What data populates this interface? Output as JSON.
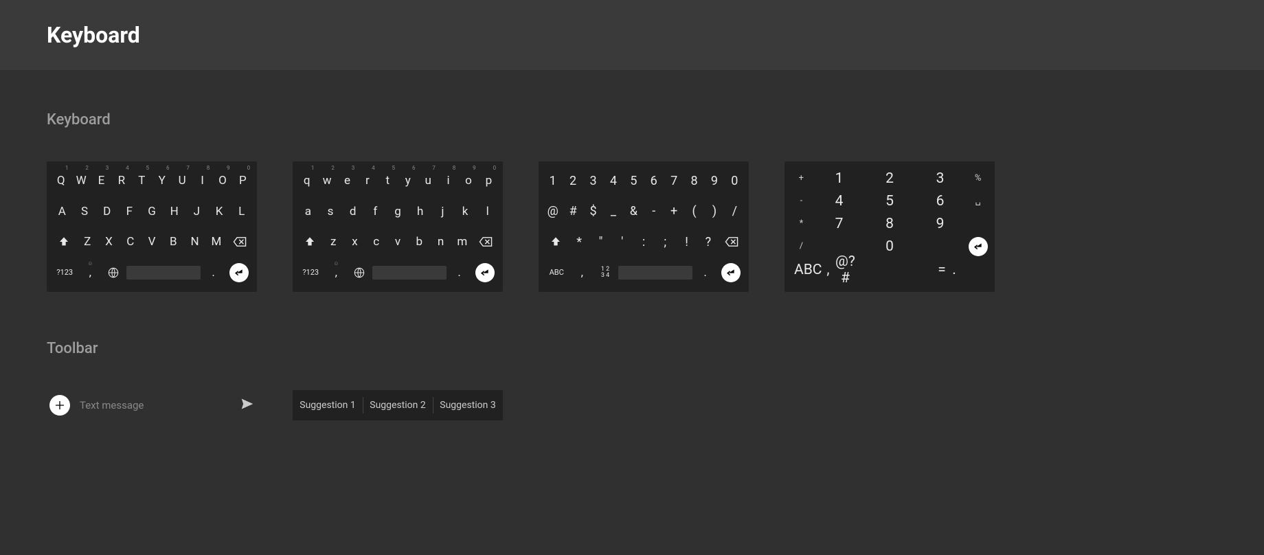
{
  "page_title": "Keyboard",
  "sections": {
    "keyboard_heading": "Keyboard",
    "toolbar_heading": "Toolbar"
  },
  "qwerty_upper": {
    "row1": [
      "Q",
      "W",
      "E",
      "R",
      "T",
      "Y",
      "U",
      "I",
      "O",
      "P"
    ],
    "row1_sup": [
      "1",
      "2",
      "3",
      "4",
      "5",
      "6",
      "7",
      "8",
      "9",
      "0"
    ],
    "row2": [
      "A",
      "S",
      "D",
      "F",
      "G",
      "H",
      "J",
      "K",
      "L"
    ],
    "row3": [
      "Z",
      "X",
      "C",
      "V",
      "B",
      "N",
      "M"
    ],
    "mode_key": "?123",
    "comma": ",",
    "period": "."
  },
  "qwerty_lower": {
    "row1": [
      "q",
      "w",
      "e",
      "r",
      "t",
      "y",
      "u",
      "i",
      "o",
      "p"
    ],
    "row1_sup": [
      "1",
      "2",
      "3",
      "4",
      "5",
      "6",
      "7",
      "8",
      "9",
      "0"
    ],
    "row2": [
      "a",
      "s",
      "d",
      "f",
      "g",
      "h",
      "j",
      "k",
      "l"
    ],
    "row3": [
      "z",
      "x",
      "c",
      "v",
      "b",
      "n",
      "m"
    ],
    "mode_key": "?123",
    "comma": ",",
    "period": "."
  },
  "symbols": {
    "row1": [
      "1",
      "2",
      "3",
      "4",
      "5",
      "6",
      "7",
      "8",
      "9",
      "0"
    ],
    "row2": [
      "@",
      "#",
      "$",
      "_",
      "&",
      "-",
      "+",
      "(",
      ")",
      "/"
    ],
    "row3": [
      "*",
      "\"",
      "'",
      ":",
      ";",
      "!",
      "?"
    ],
    "mode_key": "ABC",
    "switch_key_top": "1 2",
    "switch_key_bot": "3 4",
    "comma": ",",
    "period": "."
  },
  "numpad": {
    "left_col": [
      "+",
      "-",
      "*",
      "/"
    ],
    "grid": [
      [
        "1",
        "2",
        "3"
      ],
      [
        "4",
        "5",
        "6"
      ],
      [
        "7",
        "8",
        "9"
      ],
      [
        "",
        "0",
        ""
      ]
    ],
    "right_col": [
      "%",
      "␣",
      "",
      ""
    ],
    "bottom_left_mode": "ABC",
    "bottom_left_comma": ",",
    "bottom_left_sym": "@?#",
    "bottom_right_eq": "=",
    "bottom_right_period": "."
  },
  "toolbar": {
    "placeholder": "Text message",
    "suggestions": [
      "Suggestion 1",
      "Suggestion 2",
      "Suggestion 3"
    ]
  }
}
